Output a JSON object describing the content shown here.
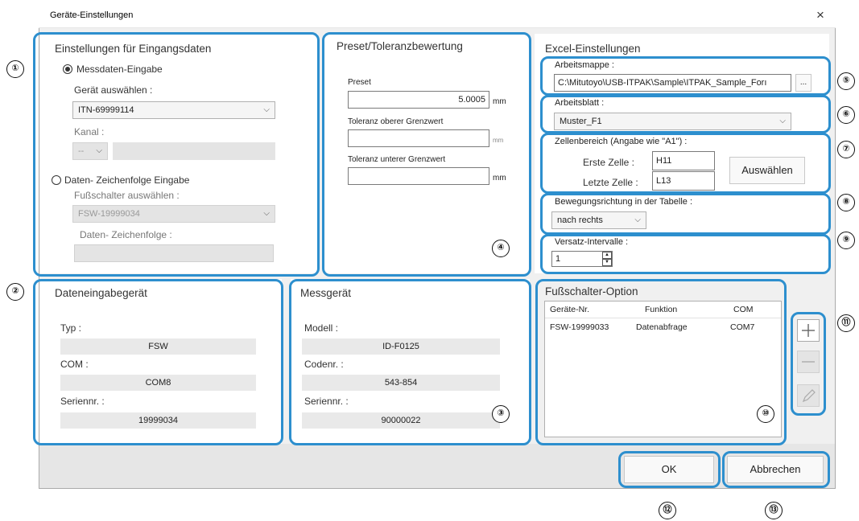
{
  "window": {
    "title": "Geräte-Einstellungen",
    "close_glyph": "×"
  },
  "input_settings": {
    "heading": "Einstellungen für Eingangsdaten",
    "meas_radio_label": "Messdaten-Eingabe",
    "device_label": "Gerät auswählen :",
    "device_value": "ITN-69999114",
    "channel_label": "Kanal :",
    "channel_value": "--",
    "string_radio_label": "Daten- Zeichenfolge Eingabe",
    "footswitch_label": "Fußschalter auswählen :",
    "footswitch_value": "FSW-19999034",
    "string_label": "Daten- Zeichenfolge :"
  },
  "preset": {
    "heading": "Preset/Toleranzbewertung",
    "preset_label": "Preset",
    "preset_value": "5.0005",
    "preset_unit": "mm",
    "upper_label": "Toleranz oberer Grenzwert",
    "upper_unit": "mm",
    "lower_label": "Toleranz unterer Grenzwert",
    "lower_unit": "mm"
  },
  "excel": {
    "heading": "Excel-Einstellungen",
    "workbook_label": "Arbeitsmappe :",
    "workbook_value": "C:\\Mitutoyo\\USB-ITPAK\\Sample\\ITPAK_Sample_Forı",
    "browse_label": "...",
    "sheet_label": "Arbeitsblatt :",
    "sheet_value": "Muster_F1",
    "range_label": "Zellenbereich (Angabe wie \"A1\") :",
    "first_cell_label": "Erste Zelle :",
    "first_cell_value": "H11",
    "last_cell_label": "Letzte Zelle :",
    "last_cell_value": "L13",
    "select_button": "Auswählen",
    "direction_label": "Bewegungsrichtung in der Tabelle :",
    "direction_value": "nach rechts",
    "offset_label": "Versatz-Intervalle :",
    "offset_value": "1"
  },
  "data_input_device": {
    "heading": "Dateneingabegerät",
    "type_label": "Typ :",
    "type_value": "FSW",
    "com_label": "COM :",
    "com_value": "COM8",
    "serial_label": "Seriennr. :",
    "serial_value": "19999034"
  },
  "gauge": {
    "heading": "Messgerät",
    "model_label": "Modell :",
    "model_value": "ID-F0125",
    "code_label": "Codenr. :",
    "code_value": "543-854",
    "serial_label": "Seriennr. :",
    "serial_value": "90000022"
  },
  "footswitch_option": {
    "heading": "Fußschalter-Option",
    "columns": [
      "Geräte-Nr.",
      "Funktion",
      "COM"
    ],
    "rows": [
      [
        "FSW-19999033",
        "Datenabfrage",
        "COM7"
      ]
    ],
    "add_icon": "plus-icon",
    "remove_icon": "minus-icon",
    "edit_icon": "pencil-icon"
  },
  "footer": {
    "ok": "OK",
    "cancel": "Abbrechen"
  },
  "callouts": {
    "n1": "①",
    "n2": "②",
    "n3": "③",
    "n4": "④",
    "n5": "⑤",
    "n6": "⑥",
    "n7": "⑦",
    "n8": "⑧",
    "n9": "⑨",
    "n10": "⑩",
    "n11": "⑪",
    "n12": "⑫",
    "n13": "⑬"
  },
  "colors": {
    "highlight": "#2d8fce",
    "dialog_bg": "#f0f0f0",
    "panel_bg": "#ffffff"
  }
}
